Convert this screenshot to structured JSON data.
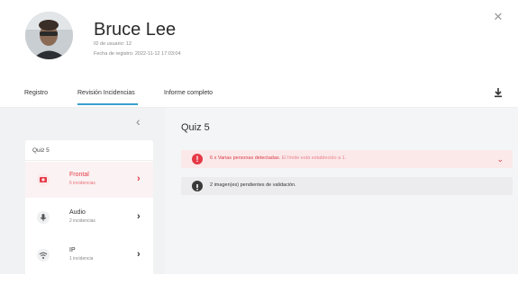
{
  "user": {
    "name": "Bruce Lee",
    "id_line": "ID de usuario: 12",
    "date_line": "Fecha de registro: 2022-11-12 17:03:04"
  },
  "tabs": [
    {
      "label": "Registro",
      "active": false
    },
    {
      "label": "Revisión Incidencias",
      "active": true
    },
    {
      "label": "Informe completo",
      "active": false
    }
  ],
  "colors": {
    "accent": "#3aa0cf",
    "danger": "#e53946",
    "danger_bg": "#fbe9ea",
    "muted_text": "#888888"
  },
  "sidebar": {
    "quiz_label": "Quiz 5",
    "items": [
      {
        "title": "Frontal",
        "subtitle": "6 incidencias",
        "icon": "camera-icon",
        "selected": true
      },
      {
        "title": "Audio",
        "subtitle": "2 incidencias",
        "icon": "microphone-icon",
        "selected": false
      },
      {
        "title": "IP",
        "subtitle": "1 incidencia",
        "icon": "wifi-icon",
        "selected": false
      }
    ]
  },
  "main": {
    "title": "Quiz 5",
    "alert": {
      "text": "6 x Varias personas detectadas.",
      "muted": "El límite está establecido a 1."
    },
    "info": {
      "text": "2 imagen(es) pendientes de validación."
    }
  }
}
